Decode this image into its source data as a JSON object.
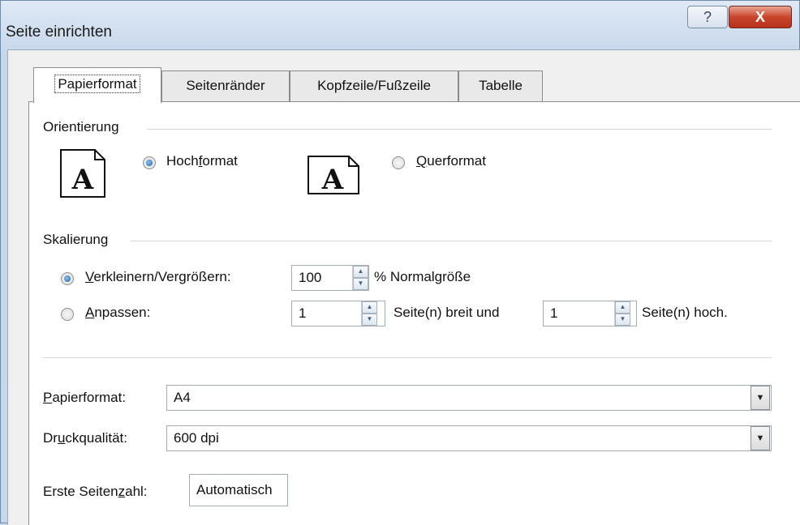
{
  "window": {
    "title": "Seite einrichten",
    "help_glyph": "?",
    "close_glyph": "X"
  },
  "tabs": [
    {
      "label": "Papierformat",
      "active": true
    },
    {
      "label": "Seitenränder",
      "active": false
    },
    {
      "label": "Kopfzeile/Fußzeile",
      "active": false
    },
    {
      "label": "Tabelle",
      "active": false
    }
  ],
  "orientation": {
    "group_label": "Orientierung",
    "portrait": {
      "pre": "Hoch",
      "key": "f",
      "post": "ormat",
      "checked": true
    },
    "landscape": {
      "pre": "",
      "key": "Q",
      "post": "uerformat",
      "checked": false
    },
    "icon_letter": "A"
  },
  "scaling": {
    "group_label": "Skalierung",
    "adjust": {
      "key": "V",
      "post": "erkleinern/Vergrößern:",
      "checked": true,
      "value": "100",
      "suffix": "% Normalgröße"
    },
    "fit": {
      "key": "A",
      "post": "npassen:",
      "checked": false,
      "wide_value": "1",
      "wide_suffix": "Seite(n) breit und",
      "tall_value": "1",
      "tall_suffix": "Seite(n) hoch."
    }
  },
  "paper_size": {
    "key": "P",
    "post": "apierformat:",
    "value": "A4"
  },
  "print_quality": {
    "pre": "Dr",
    "key": "u",
    "post": "ckqualität:",
    "value": "600 dpi"
  },
  "first_page": {
    "pre": "Erste Seiten",
    "key": "z",
    "post": "ahl:",
    "value": "Automatisch"
  },
  "colors": {
    "accent_radio": "#1c5c9e",
    "close_button": "#c9452c",
    "titlebar": "#dfe9f5"
  }
}
